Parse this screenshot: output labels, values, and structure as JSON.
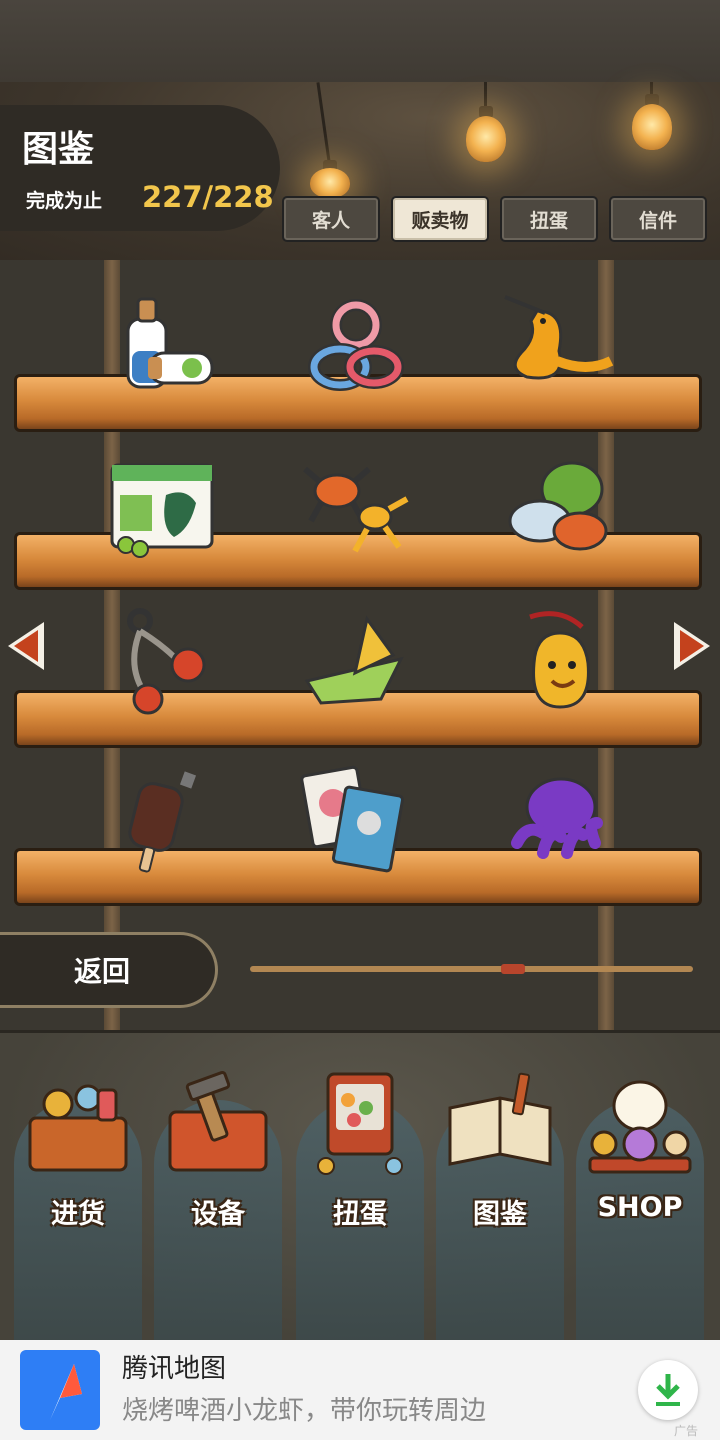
{
  "header": {
    "title": "图鉴",
    "progress_label": "完成为止",
    "progress_value": "227/228"
  },
  "tabs": [
    {
      "label": "客人",
      "active": false
    },
    {
      "label": "贩卖物",
      "active": true
    },
    {
      "label": "扭蛋",
      "active": false
    },
    {
      "label": "信件",
      "active": false
    }
  ],
  "items": [
    {
      "name": "bottles-icon"
    },
    {
      "name": "rubber-rings-icon"
    },
    {
      "name": "squeaky-toy-icon"
    },
    {
      "name": "apple-box-icon"
    },
    {
      "name": "toy-insects-icon"
    },
    {
      "name": "marbles-icon"
    },
    {
      "name": "clacker-toy-icon"
    },
    {
      "name": "paper-boat-icon"
    },
    {
      "name": "bell-charm-icon"
    },
    {
      "name": "ice-bar-icon"
    },
    {
      "name": "cards-icon"
    },
    {
      "name": "octopus-toy-icon"
    }
  ],
  "nav": {
    "back_label": "返回",
    "scroll_fraction": 0.6
  },
  "menu": [
    {
      "label": "进货",
      "icon": "stock-basket-icon"
    },
    {
      "label": "设备",
      "icon": "toolbox-icon"
    },
    {
      "label": "扭蛋",
      "icon": "gacha-machine-icon"
    },
    {
      "label": "图鉴",
      "icon": "open-book-icon"
    },
    {
      "label": "SHOP",
      "icon": "lucky-cat-icon"
    }
  ],
  "ad": {
    "title": "腾讯地图",
    "description": "烧烤啤酒小龙虾，带你玩转周边",
    "badge": "广告"
  },
  "colors": {
    "accent_gold": "#f2c64c",
    "arrow_red": "#c4421d"
  }
}
